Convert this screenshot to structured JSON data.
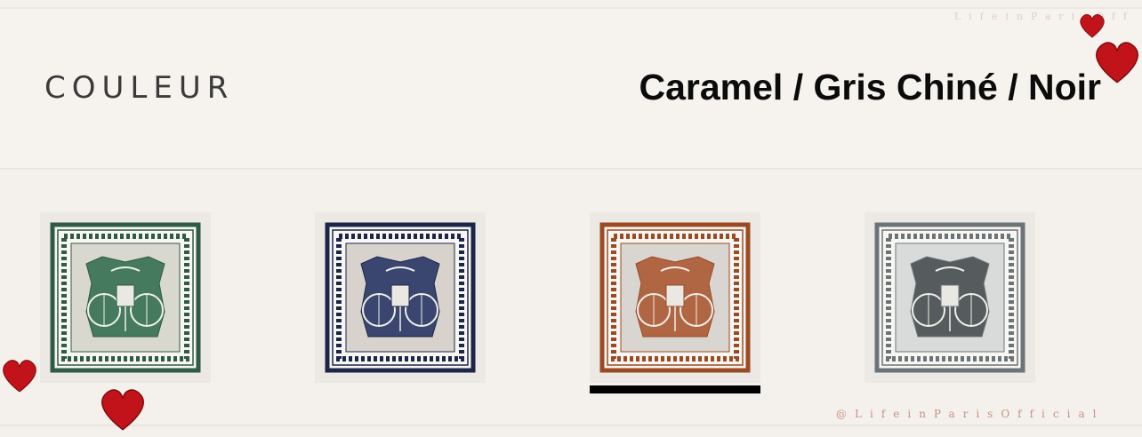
{
  "color_selector": {
    "label": "Couleur",
    "selected_value": "Caramel / Gris Chiné / Noir"
  },
  "swatches": [
    {
      "name": "green",
      "border": "#2f5a43",
      "motif": "#2c6a4a",
      "bg": "#d8d8cf",
      "selected": false
    },
    {
      "name": "navy",
      "border": "#1b2648",
      "motif": "#1e2d5f",
      "bg": "#d7d3cc",
      "selected": false
    },
    {
      "name": "caramel",
      "border": "#9c4a22",
      "motif": "#a8522a",
      "bg": "#d9d5d0",
      "selected": true
    },
    {
      "name": "grey",
      "border": "#6c7478",
      "motif": "#3e4548",
      "bg": "#d9dbdb",
      "selected": false
    }
  ],
  "watermarks": {
    "top": "LifeinParisOff",
    "bottom": "@LifeinParisOfficial"
  },
  "colors": {
    "heart": "#c2131b",
    "underline": "#000000"
  }
}
